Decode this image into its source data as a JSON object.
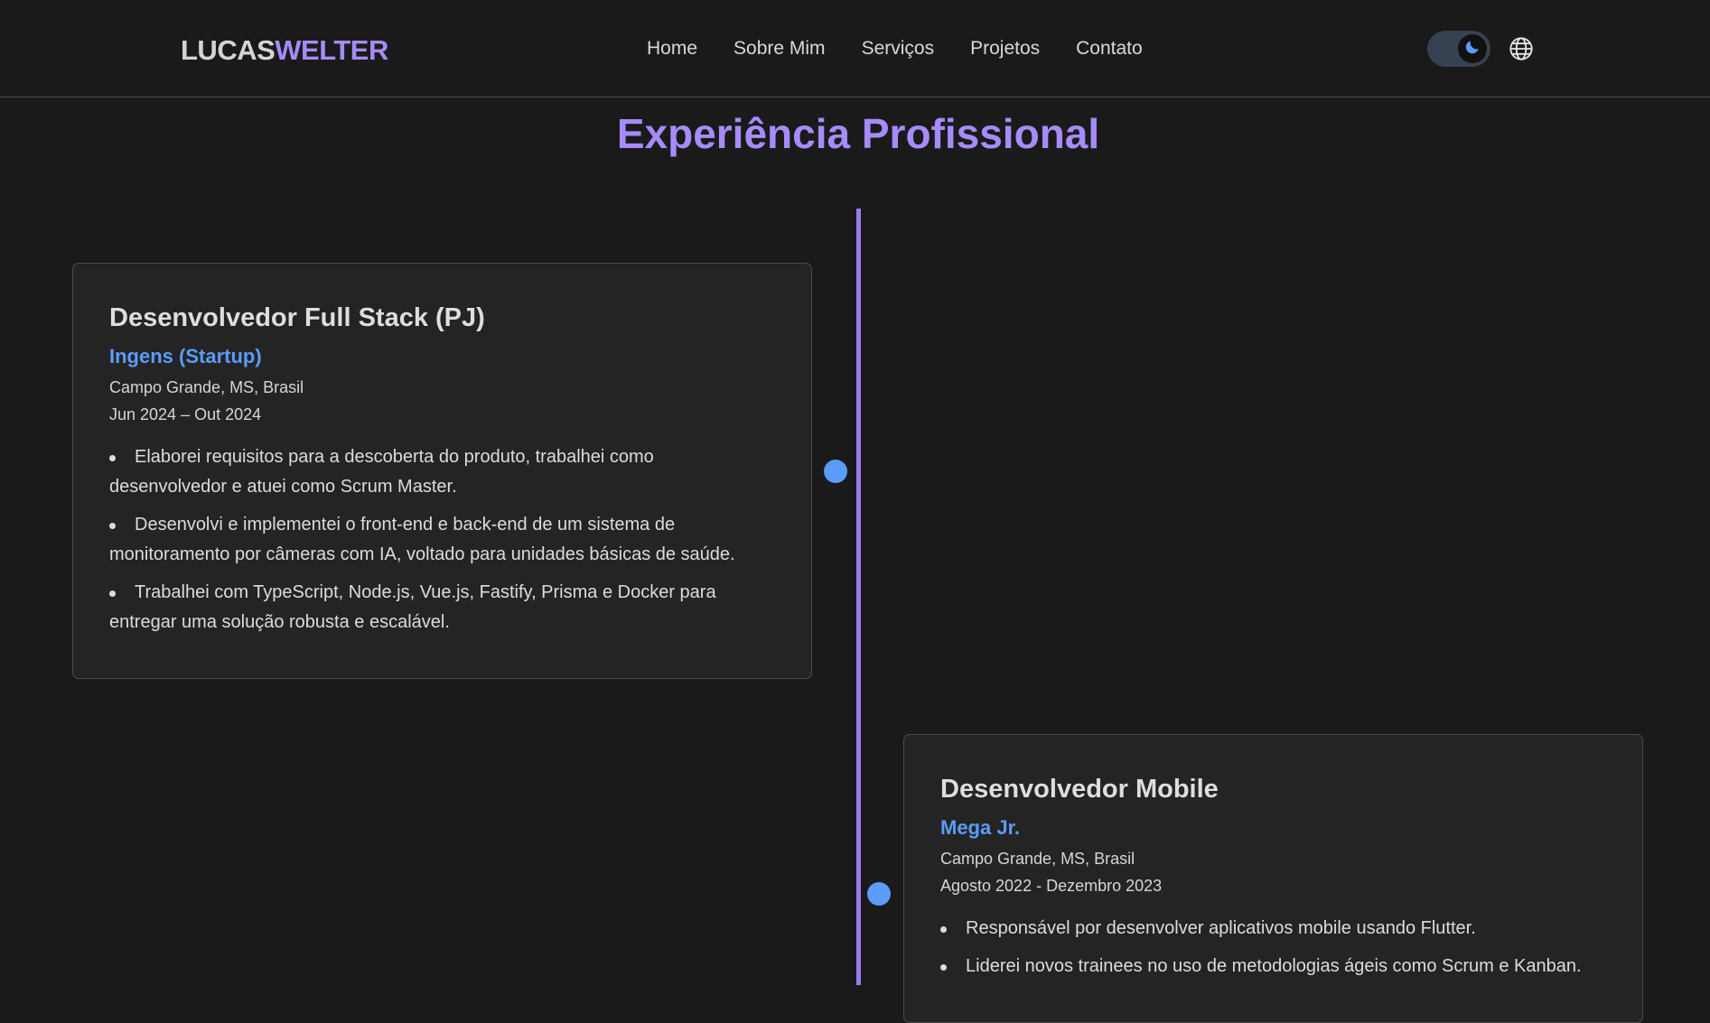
{
  "header": {
    "logo_first": "LUCAS",
    "logo_last": "WELTER",
    "nav": [
      {
        "label": "Home"
      },
      {
        "label": "Sobre Mim"
      },
      {
        "label": "Serviços"
      },
      {
        "label": "Projetos"
      },
      {
        "label": "Contato"
      }
    ],
    "theme_toggle": {
      "state": "dark",
      "icon": "moon-icon"
    },
    "language_icon": "globe-icon"
  },
  "section": {
    "title": "Experiência Profissional"
  },
  "experiences": [
    {
      "role": "Desenvolvedor Full Stack (PJ)",
      "company": "Ingens (Startup)",
      "location": "Campo Grande, MS, Brasil",
      "period": "Jun 2024 – Out 2024",
      "bullets": [
        "Elaborei requisitos para a descoberta do produto, trabalhei como desenvolvedor e atuei como Scrum Master.",
        "Desenvolvi e implementei o front-end e back-end de um sistema de monitoramento por câmeras com IA, voltado para unidades básicas de saúde.",
        "Trabalhei com TypeScript, Node.js, Vue.js, Fastify, Prisma e Docker para entregar uma solução robusta e escalável."
      ]
    },
    {
      "role": "Desenvolvedor Mobile",
      "company": "Mega Jr.",
      "location": "Campo Grande, MS, Brasil",
      "period": "Agosto 2022 - Dezembro 2023",
      "bullets": [
        "Responsável por desenvolver aplicativos mobile usando Flutter.",
        "Liderei novos trainees no uso de metodologias ágeis como Scrum e Kanban."
      ]
    }
  ],
  "colors": {
    "background": "#1a1a1a",
    "accent_purple": "#a78bfa",
    "accent_blue": "#5b9cf8",
    "card_bg": "#242424"
  }
}
